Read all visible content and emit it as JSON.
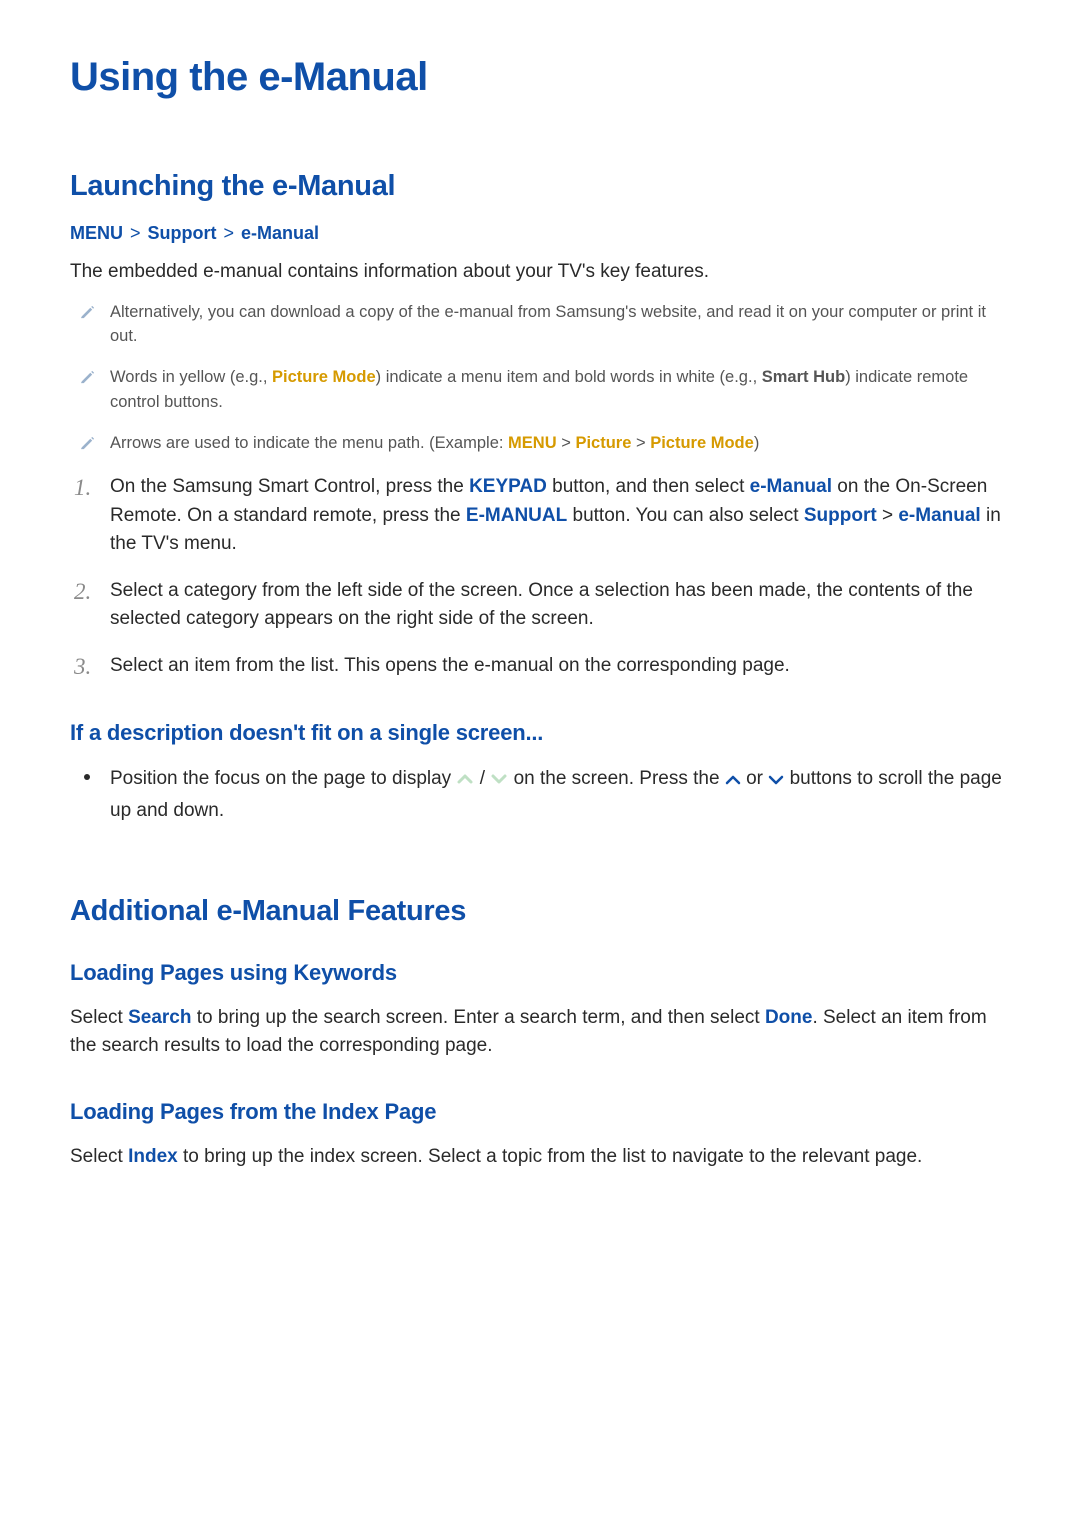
{
  "title": "Using the e-Manual",
  "section1": {
    "heading": "Launching the e-Manual",
    "breadcrumb": {
      "a": "MENU",
      "b": "Support",
      "c": "e-Manual"
    },
    "intro": "The embedded e-manual contains information about your TV's key features.",
    "notes": {
      "n1": "Alternatively, you can download a copy of the e-manual from Samsung's website, and read it on your computer or print it out.",
      "n2a": "Words in yellow (e.g., ",
      "n2_yellow": "Picture Mode",
      "n2b": ") indicate a menu item and bold words in white (e.g., ",
      "n2_bold": "Smart Hub",
      "n2c": ") indicate remote control buttons.",
      "n3a": "Arrows are used to indicate the menu path. (Example: ",
      "n3_m": "MENU",
      "n3_sep": " > ",
      "n3_p": "Picture",
      "n3_pm": "Picture Mode",
      "n3b": ")"
    },
    "steps": {
      "s1a": "On the Samsung Smart Control, press the ",
      "s1_keypad": "KEYPAD",
      "s1b": " button, and then select ",
      "s1_eman": "e-Manual",
      "s1c": " on the On-Screen Remote. On a standard remote, press the ",
      "s1_emanual_btn": "E-MANUAL",
      "s1d": " button. You can also select ",
      "s1_support": "Support",
      "s1_gt": " > ",
      "s1_eman2": "e-Manual",
      "s1e": " in the TV's menu.",
      "s2": "Select a category from the left side of the screen. Once a selection has been made, the contents of the selected category appears on the right side of the screen.",
      "s3": "Select an item from the list. This opens the e-manual on the corresponding page."
    },
    "sub": {
      "heading": "If a description doesn't fit on a single screen...",
      "b1a": "Position the focus on the page to display ",
      "b1b": " / ",
      "b1c": " on the screen. Press the ",
      "b1d": " or ",
      "b1e": " buttons to scroll the page up and down."
    }
  },
  "section2": {
    "heading": "Additional e-Manual Features",
    "sub1": {
      "heading": "Loading Pages using Keywords",
      "p_a": "Select ",
      "p_search": "Search",
      "p_b": " to bring up the search screen. Enter a search term, and then select ",
      "p_done": "Done",
      "p_c": ". Select an item from the search results to load the corresponding page."
    },
    "sub2": {
      "heading": "Loading Pages from the Index Page",
      "p_a": "Select ",
      "p_index": "Index",
      "p_b": " to bring up the index screen. Select a topic from the list to navigate to the relevant page."
    }
  },
  "nums": {
    "n1": "1.",
    "n2": "2.",
    "n3": "3."
  }
}
